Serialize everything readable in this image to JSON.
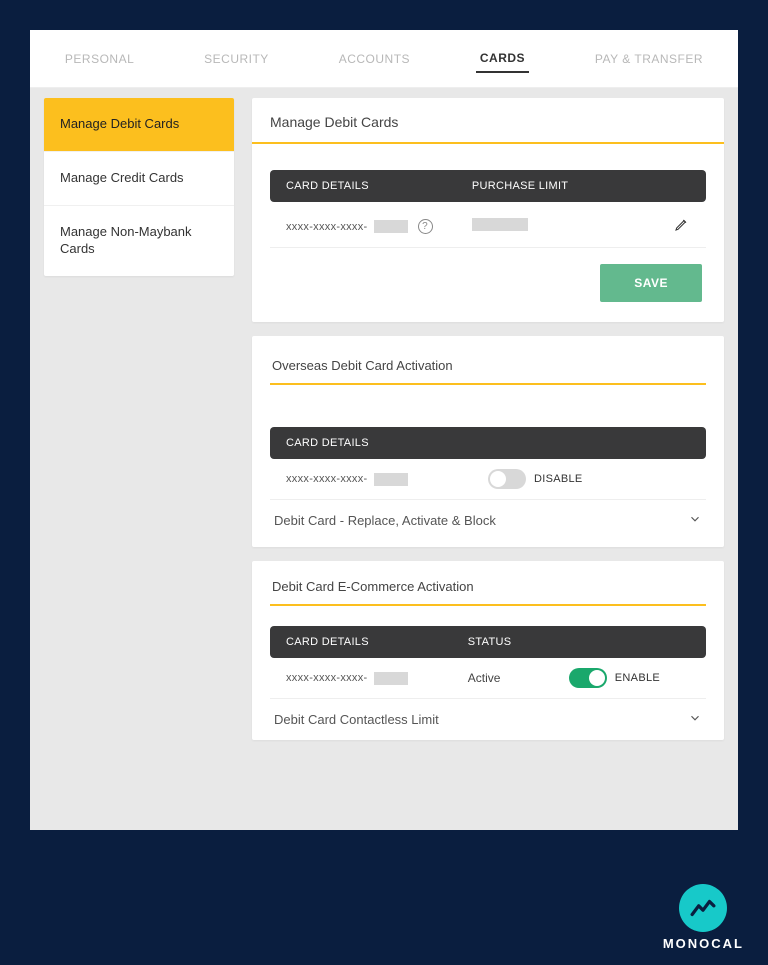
{
  "tabs": {
    "personal": "PERSONAL",
    "security": "SECURITY",
    "accounts": "ACCOUNTS",
    "cards": "CARDS",
    "pay": "PAY & TRANSFER"
  },
  "sidebar": {
    "items": [
      {
        "label": "Manage Debit Cards"
      },
      {
        "label": "Manage Credit Cards"
      },
      {
        "label": "Manage Non-Maybank Cards"
      }
    ]
  },
  "panels": {
    "manage_debit": {
      "title": "Manage Debit Cards",
      "header_col1": "CARD DETAILS",
      "header_col2": "PURCHASE LIMIT",
      "card_mask": "xxxx-xxxx-xxxx-",
      "save_label": "SAVE"
    },
    "overseas": {
      "title": "Overseas Debit Card Activation",
      "header_col1": "CARD DETAILS",
      "card_mask": "xxxx-xxxx-xxxx-",
      "toggle_label": "DISABLE",
      "collapsible": "Debit Card - Replace, Activate & Block"
    },
    "ecom": {
      "title": "Debit Card E-Commerce Activation",
      "header_col1": "CARD DETAILS",
      "header_col2": "STATUS",
      "card_mask": "xxxx-xxxx-xxxx-",
      "status": "Active",
      "toggle_label": "ENABLE",
      "collapsible": "Debit Card Contactless Limit"
    }
  },
  "watermark": "MONOCAL"
}
